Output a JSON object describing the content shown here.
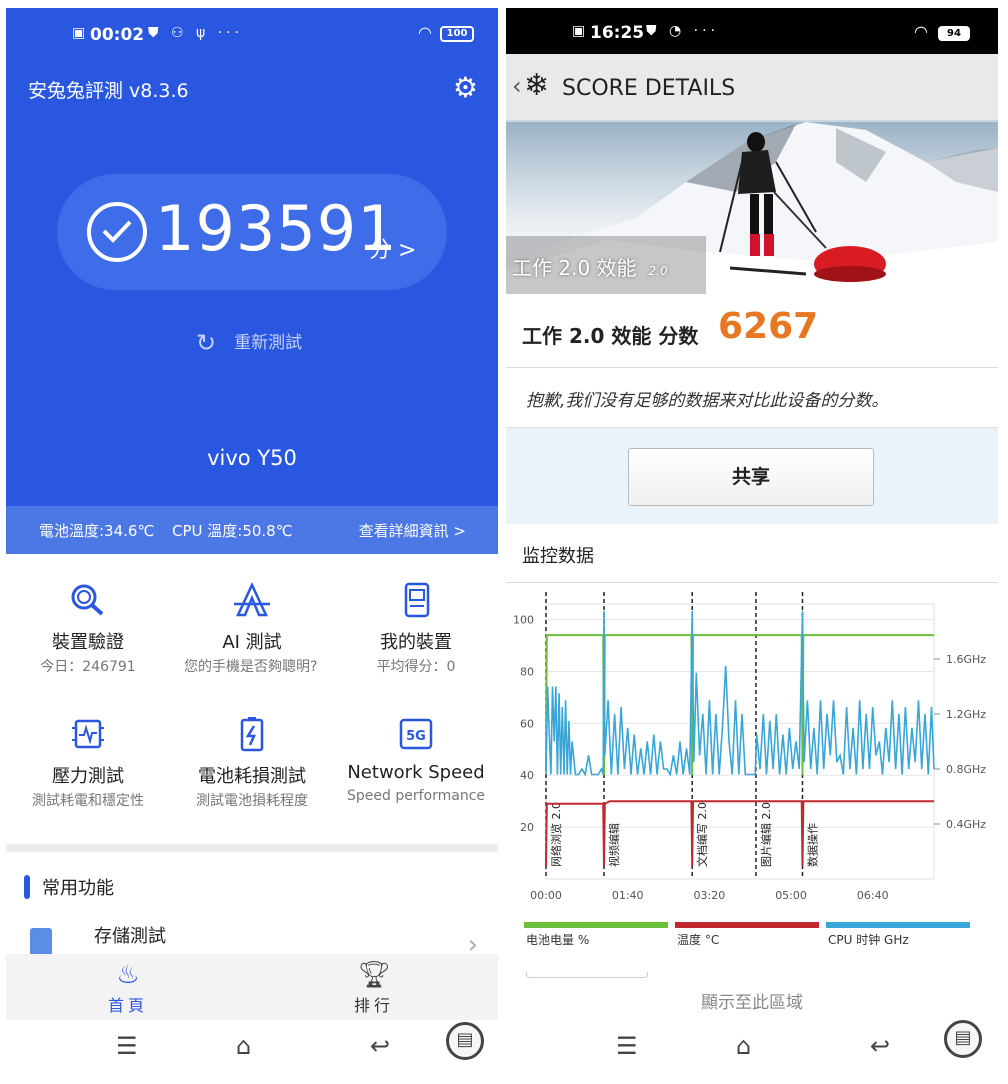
{
  "left": {
    "status": {
      "time": "00:02",
      "extra": "⛊ ⚇ ψ ···",
      "battery": "100"
    },
    "app_title": "安兔兔評測 v8.3.6",
    "score": {
      "value": "193591",
      "unit": "分 >"
    },
    "retest_label": "重新測試",
    "device_name": "vivo Y50",
    "temps": {
      "battery": "電池溫度:34.6℃",
      "cpu": "CPU 溫度:50.8℃",
      "details": "查看詳細資訊 >"
    },
    "features": [
      {
        "title": "裝置驗證",
        "sub": "今日：246791",
        "icon": "magnifier-icon"
      },
      {
        "title": "AI 測試",
        "sub": "您的手機是否夠聰明?",
        "icon": "ai-icon"
      },
      {
        "title": "我的裝置",
        "sub": "平均得分：0",
        "icon": "device-icon"
      },
      {
        "title": "壓力測試",
        "sub": "測試耗電和穩定性",
        "icon": "chip-icon"
      },
      {
        "title": "電池耗損測試",
        "sub": "測試電池損耗程度",
        "icon": "battery-icon"
      },
      {
        "title": "Network Speed",
        "sub": "Speed performance",
        "icon": "5g-icon"
      }
    ],
    "section_title": "常用功能",
    "storage_label": "存儲測試",
    "tabs": {
      "home": "首頁",
      "rank": "排行"
    }
  },
  "right": {
    "status": {
      "time": "16:25",
      "extra": "⛊ ◔ ···",
      "battery": "94"
    },
    "header_title": "SCORE DETAILS",
    "banner_label": "工作 2.0 效能",
    "banner_version": "2.0",
    "score_label": "工作 2.0 效能 分数",
    "score_value": "6267",
    "sorry_text": "抱歉,我们没有足够的数据来对比此设备的分数。",
    "share_label": "共享",
    "monitor_title": "监控数据",
    "bottom_label": "顯示至此區域",
    "colors": {
      "battery": "#6abf3c",
      "temperature": "#c0282f",
      "cpu": "#3aa6d8"
    }
  },
  "chart_data": {
    "type": "line",
    "title": "监控数据",
    "x_ticks": [
      "00:00",
      "01:40",
      "03:20",
      "05:00",
      "06:40"
    ],
    "y_left_ticks": [
      100,
      80,
      60,
      40,
      20
    ],
    "y_right_ticks": [
      "1.6GHz",
      "1.2GHz",
      "0.8GHz",
      "0.4GHz"
    ],
    "ylim_left": [
      0,
      106
    ],
    "ylim_right": [
      0,
      2.0
    ],
    "xlim_seconds": [
      0,
      475
    ],
    "segments": [
      {
        "label": "网络浏览 2.0",
        "start": 0
      },
      {
        "label": "视频编辑",
        "start": 71
      },
      {
        "label": "文档编写 2.0",
        "start": 179
      },
      {
        "label": "图片编辑 2.0",
        "start": 257
      },
      {
        "label": "数据操作",
        "start": 314
      }
    ],
    "series": [
      {
        "name": "电池电量 %",
        "color": "#6abf3c",
        "axis": "left",
        "points": [
          [
            0,
            43
          ],
          [
            1,
            94
          ],
          [
            70,
            94
          ],
          [
            71,
            40
          ],
          [
            72,
            94
          ],
          [
            178,
            94
          ],
          [
            179,
            40
          ],
          [
            180,
            94
          ],
          [
            313,
            94
          ],
          [
            314,
            40
          ],
          [
            315,
            94
          ],
          [
            475,
            94
          ]
        ]
      },
      {
        "name": "温度 °C",
        "color": "#c0282f",
        "axis": "left",
        "points": [
          [
            0,
            5
          ],
          [
            1,
            29
          ],
          [
            70,
            29
          ],
          [
            71,
            5
          ],
          [
            72,
            29
          ],
          [
            78,
            30
          ],
          [
            178,
            30
          ],
          [
            179,
            5
          ],
          [
            180,
            30
          ],
          [
            313,
            30
          ],
          [
            314,
            5
          ],
          [
            315,
            30
          ],
          [
            475,
            30
          ]
        ]
      },
      {
        "name": "CPU 时钟 GHz",
        "color": "#3aa6d8",
        "axis": "right",
        "points": [
          [
            0,
            0.76
          ],
          [
            2,
            1.4
          ],
          [
            4,
            1.05
          ],
          [
            6,
            0.76
          ],
          [
            8,
            1.4
          ],
          [
            10,
            1.0
          ],
          [
            12,
            1.4
          ],
          [
            14,
            0.76
          ],
          [
            16,
            1.35
          ],
          [
            18,
            0.76
          ],
          [
            20,
            1.25
          ],
          [
            22,
            0.76
          ],
          [
            24,
            1.3
          ],
          [
            26,
            0.76
          ],
          [
            28,
            1.15
          ],
          [
            30,
            0.76
          ],
          [
            32,
            1.0
          ],
          [
            36,
            0.76
          ],
          [
            40,
            0.76
          ],
          [
            44,
            0.8
          ],
          [
            48,
            0.76
          ],
          [
            52,
            0.9
          ],
          [
            56,
            0.76
          ],
          [
            60,
            0.76
          ],
          [
            64,
            0.76
          ],
          [
            68,
            0.8
          ],
          [
            70,
            0.76
          ],
          [
            71,
            1.95
          ],
          [
            72,
            0.9
          ],
          [
            76,
            1.3
          ],
          [
            80,
            0.76
          ],
          [
            84,
            1.2
          ],
          [
            88,
            0.76
          ],
          [
            92,
            1.25
          ],
          [
            96,
            0.8
          ],
          [
            100,
            1.1
          ],
          [
            104,
            0.76
          ],
          [
            108,
            1.05
          ],
          [
            112,
            0.76
          ],
          [
            116,
            0.95
          ],
          [
            120,
            0.76
          ],
          [
            124,
            1.0
          ],
          [
            128,
            0.76
          ],
          [
            132,
            1.05
          ],
          [
            136,
            0.76
          ],
          [
            140,
            1.0
          ],
          [
            144,
            0.8
          ],
          [
            148,
            0.8
          ],
          [
            152,
            0.76
          ],
          [
            156,
            0.9
          ],
          [
            160,
            0.76
          ],
          [
            164,
            1.0
          ],
          [
            168,
            0.76
          ],
          [
            172,
            0.95
          ],
          [
            176,
            0.76
          ],
          [
            179,
            1.95
          ],
          [
            181,
            0.85
          ],
          [
            184,
            1.5
          ],
          [
            188,
            0.9
          ],
          [
            192,
            1.2
          ],
          [
            196,
            0.76
          ],
          [
            200,
            1.3
          ],
          [
            204,
            0.76
          ],
          [
            208,
            1.2
          ],
          [
            212,
            0.76
          ],
          [
            216,
            1.1
          ],
          [
            220,
            1.55
          ],
          [
            224,
            1.0
          ],
          [
            228,
            0.76
          ],
          [
            232,
            1.3
          ],
          [
            236,
            0.76
          ],
          [
            240,
            1.2
          ],
          [
            244,
            0.76
          ],
          [
            248,
            0.76
          ],
          [
            252,
            0.76
          ],
          [
            256,
            0.76
          ],
          [
            258,
            1.05
          ],
          [
            262,
            0.8
          ],
          [
            266,
            1.2
          ],
          [
            270,
            0.76
          ],
          [
            274,
            1.15
          ],
          [
            278,
            0.8
          ],
          [
            282,
            1.2
          ],
          [
            286,
            0.76
          ],
          [
            290,
            1.05
          ],
          [
            294,
            0.76
          ],
          [
            298,
            1.1
          ],
          [
            302,
            0.8
          ],
          [
            306,
            1.0
          ],
          [
            310,
            0.8
          ],
          [
            314,
            1.95
          ],
          [
            316,
            0.85
          ],
          [
            320,
            1.3
          ],
          [
            324,
            0.8
          ],
          [
            328,
            1.1
          ],
          [
            332,
            0.76
          ],
          [
            336,
            1.3
          ],
          [
            340,
            0.8
          ],
          [
            344,
            1.2
          ],
          [
            348,
            0.9
          ],
          [
            352,
            1.3
          ],
          [
            356,
            0.85
          ],
          [
            360,
            0.9
          ],
          [
            364,
            0.76
          ],
          [
            368,
            1.25
          ],
          [
            372,
            0.8
          ],
          [
            376,
            1.1
          ],
          [
            380,
            0.76
          ],
          [
            384,
            1.3
          ],
          [
            388,
            0.8
          ],
          [
            392,
            1.2
          ],
          [
            396,
            0.8
          ],
          [
            400,
            1.25
          ],
          [
            404,
            0.9
          ],
          [
            408,
            1.0
          ],
          [
            412,
            0.76
          ],
          [
            416,
            1.1
          ],
          [
            420,
            0.85
          ],
          [
            424,
            1.3
          ],
          [
            428,
            0.8
          ],
          [
            432,
            1.2
          ],
          [
            436,
            0.76
          ],
          [
            440,
            1.25
          ],
          [
            444,
            0.8
          ],
          [
            448,
            1.1
          ],
          [
            452,
            0.85
          ],
          [
            456,
            1.3
          ],
          [
            460,
            0.8
          ],
          [
            464,
            1.2
          ],
          [
            468,
            0.76
          ],
          [
            472,
            1.25
          ],
          [
            475,
            0.8
          ]
        ]
      }
    ]
  }
}
